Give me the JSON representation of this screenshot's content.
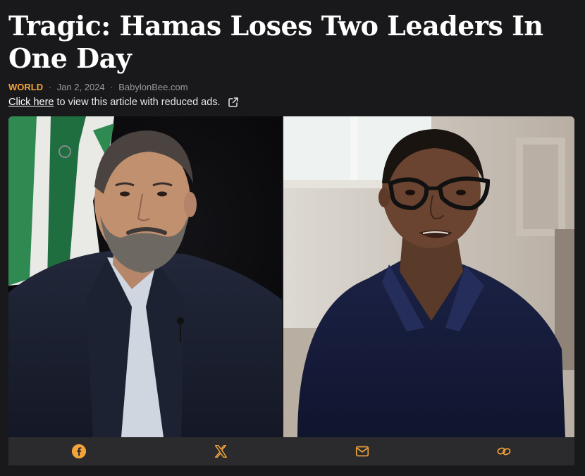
{
  "article": {
    "title": "Tragic: Hamas Loses Two Leaders In One Day",
    "category": "WORLD",
    "date": "Jan 2, 2024",
    "source": "BabylonBee.com",
    "separator": "·"
  },
  "reduced_ads": {
    "link_text": "Click here",
    "rest_text": "to view this article with reduced ads."
  },
  "share": {
    "icons": [
      "facebook-icon",
      "x-icon",
      "email-icon",
      "link-icon"
    ]
  },
  "colors": {
    "background": "#19191b",
    "accent": "#f2a33a",
    "share_bar": "#2b2b2d",
    "meta_text": "#9a9a9a"
  }
}
